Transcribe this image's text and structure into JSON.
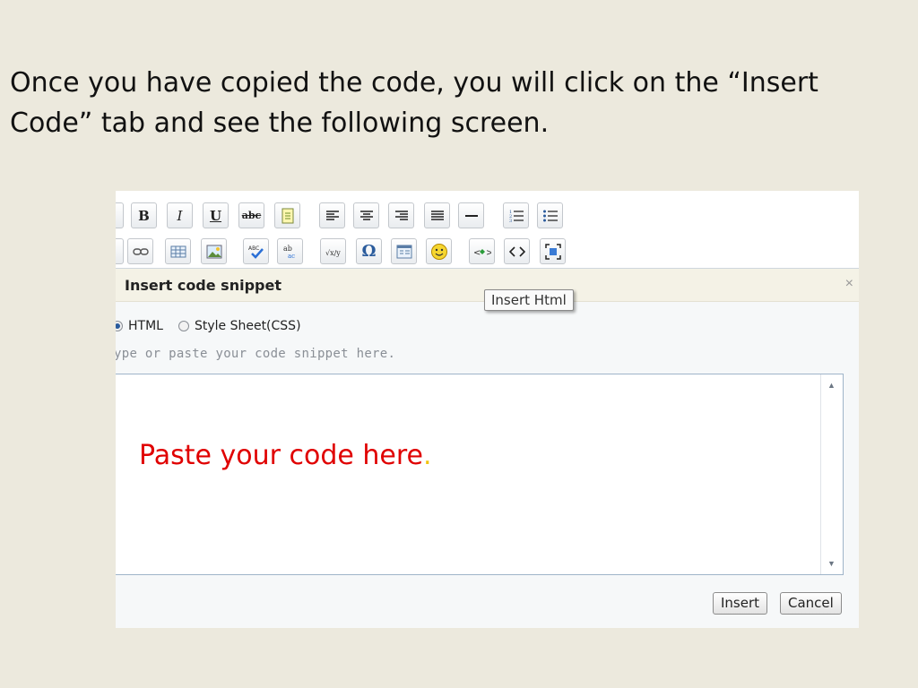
{
  "slide": {
    "line1": "Once you have copied the code, you will click on the “Insert",
    "line2": "Code” tab and see the following screen."
  },
  "toolbar": {
    "bold_label": "B",
    "italic_label": "I",
    "underline_label": "U",
    "strike_label": "abc"
  },
  "dialog": {
    "title": "Insert code snippet",
    "close_label": "×",
    "tooltip": "Insert Html",
    "radio_html": "HTML",
    "radio_css": "Style Sheet(CSS)",
    "hint": "ype or paste your code snippet here.",
    "code_text": "Paste your code here",
    "code_dot": ".",
    "insert_button": "Insert",
    "cancel_button": "Cancel"
  },
  "colors": {
    "slide_bg": "#ece9dd",
    "code_text": "#e00000",
    "code_dot": "#f1c40f"
  }
}
